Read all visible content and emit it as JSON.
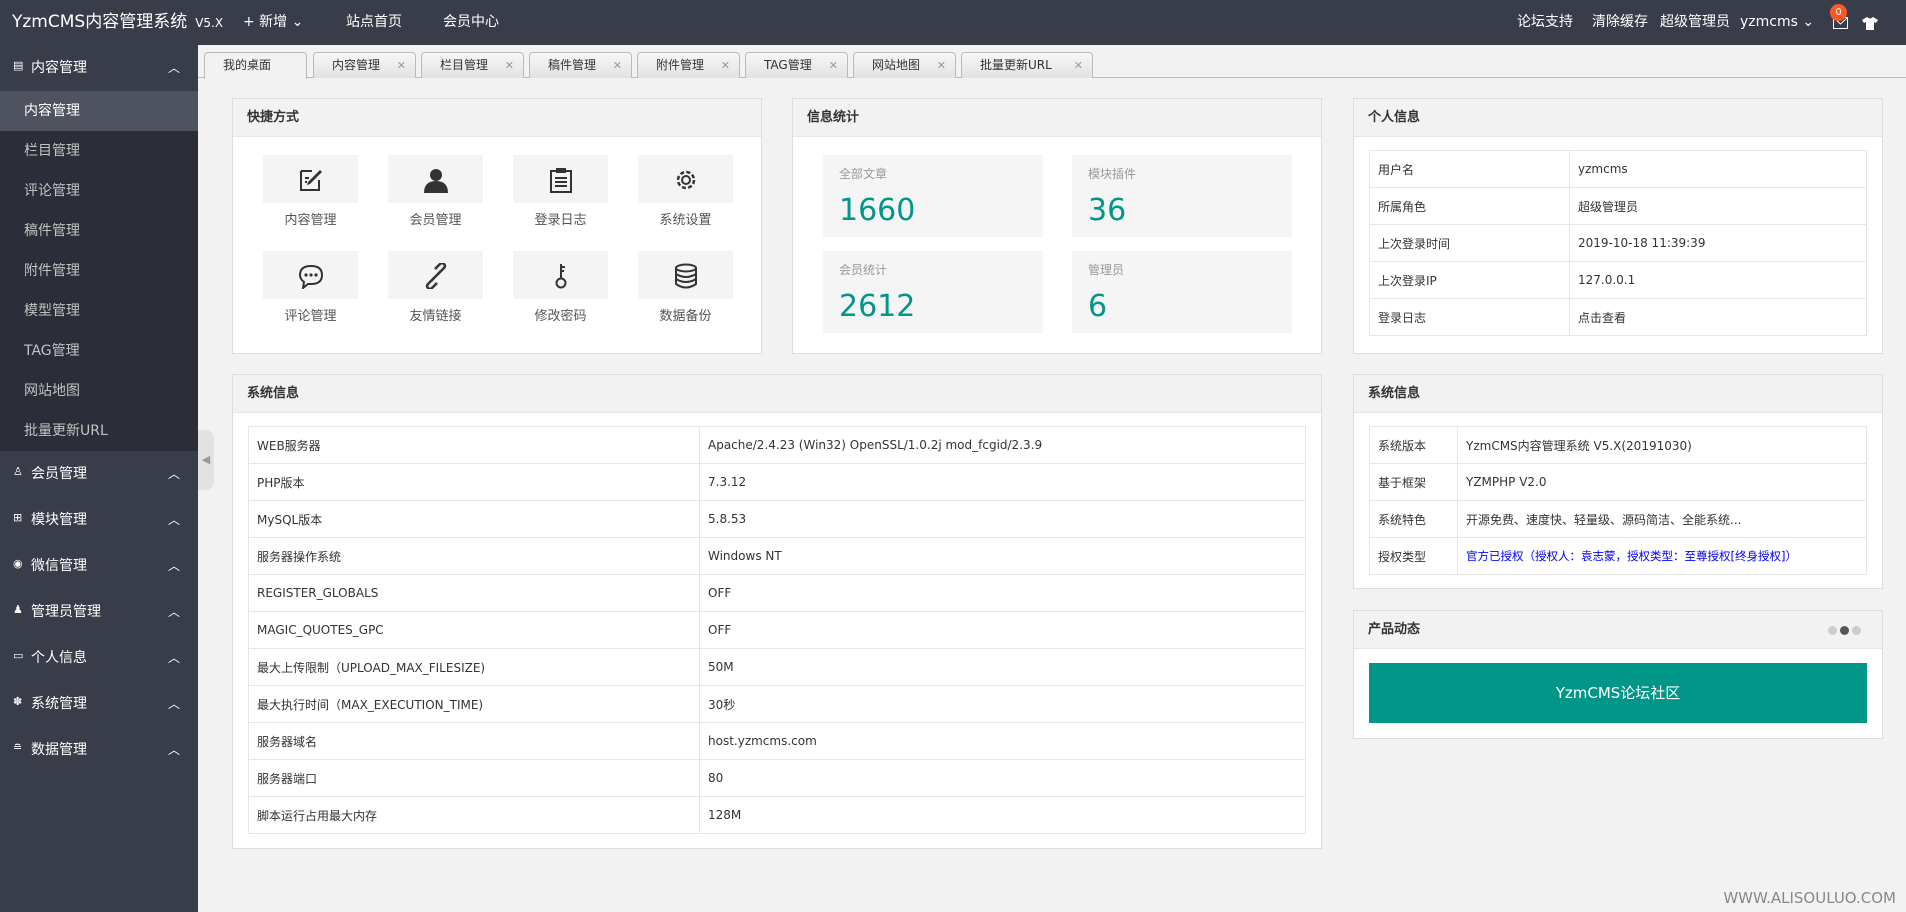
{
  "topbar": {
    "brand": "YzmCMS内容管理系统",
    "version": "V5.X",
    "nav": [
      "+ 新增 ⌄",
      "站点首页",
      "会员中心"
    ],
    "right": [
      "论坛支持",
      "清除缓存",
      "超级管理员",
      "yzmcms ⌄"
    ],
    "mail_count": "0",
    "mail_icon": "mail-icon",
    "shirt_icon": "shirt-icon"
  },
  "sidebar": {
    "groups": [
      {
        "label": "内容管理",
        "icon": "document-icon",
        "subs": [
          "内容管理",
          "栏目管理",
          "评论管理",
          "稿件管理",
          "附件管理",
          "模型管理",
          "TAG管理",
          "网站地图",
          "批量更新URL"
        ]
      },
      {
        "label": "会员管理",
        "icon": "user-icon"
      },
      {
        "label": "模块管理",
        "icon": "grid-icon"
      },
      {
        "label": "微信管理",
        "icon": "wechat-icon"
      },
      {
        "label": "管理员管理",
        "icon": "admin-icon"
      },
      {
        "label": "个人信息",
        "icon": "card-icon"
      },
      {
        "label": "系统管理",
        "icon": "gear-icon"
      },
      {
        "label": "数据管理",
        "icon": "database-icon"
      }
    ],
    "active_sub": "内容管理"
  },
  "tabs": [
    "我的桌面",
    "内容管理",
    "栏目管理",
    "稿件管理",
    "附件管理",
    "TAG管理",
    "网站地图",
    "批量更新URL"
  ],
  "quick": {
    "title": "快捷方式",
    "items": [
      {
        "label": "内容管理",
        "icon": "edit-icon"
      },
      {
        "label": "会员管理",
        "icon": "user-icon"
      },
      {
        "label": "登录日志",
        "icon": "clipboard-icon"
      },
      {
        "label": "系统设置",
        "icon": "gear-icon"
      },
      {
        "label": "评论管理",
        "icon": "comment-icon"
      },
      {
        "label": "友情链接",
        "icon": "link-icon"
      },
      {
        "label": "修改密码",
        "icon": "key-icon"
      },
      {
        "label": "数据备份",
        "icon": "database-icon"
      }
    ]
  },
  "stats": {
    "title": "信息统计",
    "items": [
      {
        "label": "全部文章",
        "value": "1660"
      },
      {
        "label": "模块插件",
        "value": "36"
      },
      {
        "label": "会员统计",
        "value": "2612"
      },
      {
        "label": "管理员",
        "value": "6"
      }
    ]
  },
  "profile": {
    "title": "个人信息",
    "rows": [
      [
        "用户名",
        "yzmcms"
      ],
      [
        "所属角色",
        "超级管理员"
      ],
      [
        "上次登录时间",
        "2019-10-18 11:39:39"
      ],
      [
        "上次登录IP",
        "127.0.0.1"
      ],
      [
        "登录日志",
        "点击查看"
      ]
    ]
  },
  "sysinfo": {
    "title": "系统信息",
    "rows": [
      [
        "WEB服务器",
        "Apache/2.4.23 (Win32) OpenSSL/1.0.2j mod_fcgid/2.3.9"
      ],
      [
        "PHP版本",
        "7.3.12"
      ],
      [
        "MySQL版本",
        "5.8.53"
      ],
      [
        "服务器操作系统",
        "Windows NT"
      ],
      [
        "REGISTER_GLOBALS",
        "OFF"
      ],
      [
        "MAGIC_QUOTES_GPC",
        "OFF"
      ],
      [
        "最大上传限制（UPLOAD_MAX_FILESIZE)",
        "50M"
      ],
      [
        "最大执行时间（MAX_EXECUTION_TIME)",
        "30秒"
      ],
      [
        "服务器域名",
        "host.yzmcms.com"
      ],
      [
        "服务器端口",
        "80"
      ],
      [
        "脚本运行占用最大内存",
        "128M"
      ]
    ]
  },
  "sysinfo2": {
    "title": "系统信息",
    "rows": [
      [
        "系统版本",
        "YzmCMS内容管理系统 V5.X(20191030)"
      ],
      [
        "基于框架",
        "YZMPHP V2.0"
      ],
      [
        "系统特色",
        "开源免费、速度快、轻量级、源码简洁、全能系统..."
      ],
      [
        "授权类型",
        "官方已授权（授权人：袁志蒙，授权类型：至尊授权[终身授权]）"
      ]
    ],
    "link_color": "#0000ff"
  },
  "product": {
    "title": "产品动态",
    "button": "YzmCMS论坛社区"
  },
  "watermark": "WWW.ALISOULUO.COM",
  "colors": {
    "accent": "#009688",
    "topbar": "#393d49",
    "badge": "#ff5722"
  }
}
